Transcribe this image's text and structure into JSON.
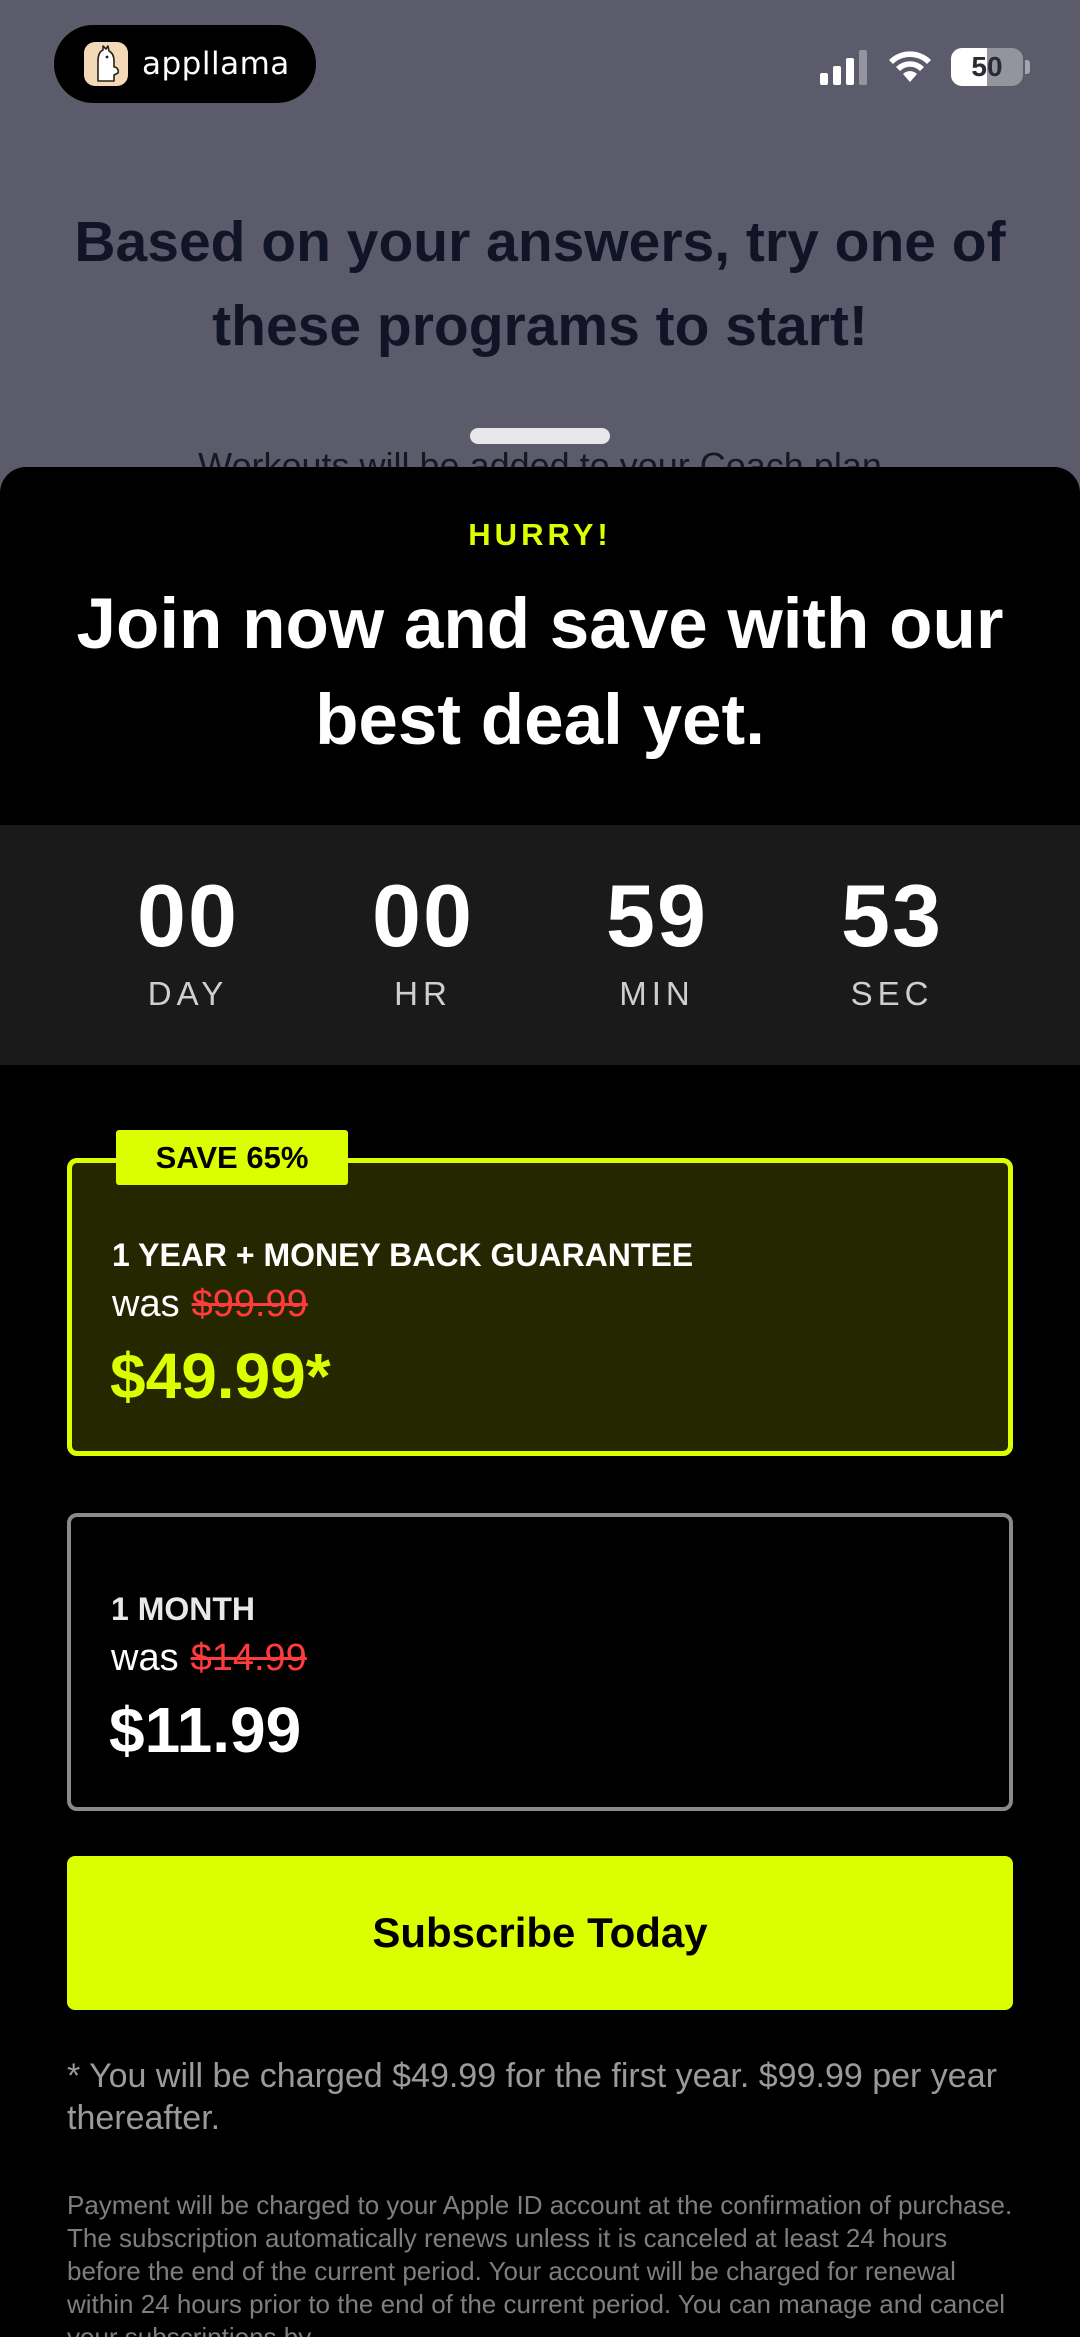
{
  "app": {
    "name": "appllama"
  },
  "status_bar": {
    "battery_text": "50",
    "battery_level": 0.5
  },
  "background": {
    "headline": "Based on your answers, try one of these programs to start!",
    "subtext": "Workouts will be added to your Coach plan"
  },
  "sheet": {
    "eyebrow": "HURRY!",
    "title": "Join now and save with our best deal yet.",
    "timer": [
      {
        "value": "00",
        "label": "DAY"
      },
      {
        "value": "00",
        "label": "HR"
      },
      {
        "value": "59",
        "label": "MIN"
      },
      {
        "value": "53",
        "label": "SEC"
      }
    ],
    "plans": [
      {
        "badge": "SAVE 65%",
        "name": "1 YEAR + MONEY BACK GUARANTEE",
        "was_label": "was",
        "old_price": "$99.99",
        "price": "$49.99*",
        "selected": true
      },
      {
        "name": "1 MONTH",
        "was_label": "was",
        "old_price": "$14.99",
        "price": "$11.99",
        "selected": false
      }
    ],
    "cta_label": "Subscribe Today",
    "charge_note": "* You will be charged $49.99 for the first year. $99.99 per year thereafter.",
    "legal": "Payment will be charged to your Apple ID account at the confirmation of purchase. The subscription automatically renews unless it is canceled at least 24 hours before the end of the current period. Your account will be charged for renewal within 24 hours prior to the end of the current period. You can manage and cancel your subscriptions by"
  },
  "colors": {
    "accent": "#dcff00",
    "strike": "#ff3b3b",
    "sheet_bg": "#000000",
    "dim_bg": "#5b5b6b"
  }
}
